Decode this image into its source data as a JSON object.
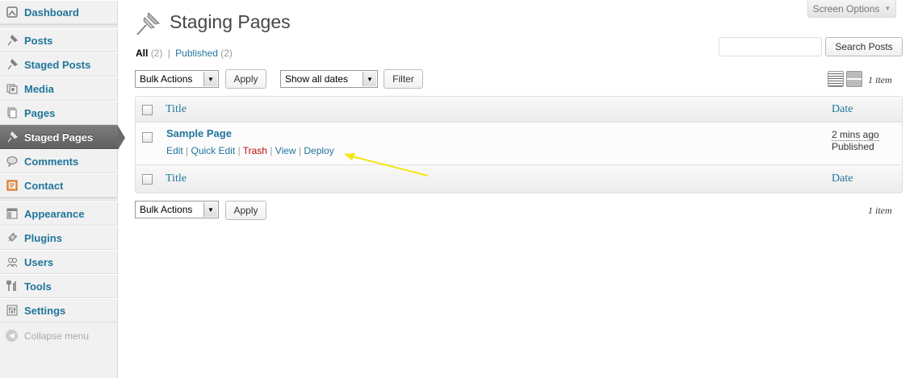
{
  "sidebar": {
    "items": [
      {
        "label": "Dashboard",
        "icon": "dashboard-icon"
      },
      {
        "label": "Posts",
        "icon": "pin-icon"
      },
      {
        "label": "Staged Posts",
        "icon": "pin-icon"
      },
      {
        "label": "Media",
        "icon": "media-icon"
      },
      {
        "label": "Pages",
        "icon": "pages-icon"
      },
      {
        "label": "Staged Pages",
        "icon": "pin-icon",
        "active": true
      },
      {
        "label": "Comments",
        "icon": "comment-icon"
      },
      {
        "label": "Contact",
        "icon": "contact-icon"
      },
      {
        "label": "Appearance",
        "icon": "appearance-icon"
      },
      {
        "label": "Plugins",
        "icon": "plugin-icon"
      },
      {
        "label": "Users",
        "icon": "users-icon"
      },
      {
        "label": "Tools",
        "icon": "tools-icon"
      },
      {
        "label": "Settings",
        "icon": "settings-icon"
      }
    ],
    "collapse_label": "Collapse menu"
  },
  "screen_options": "Screen Options",
  "page_title": "Staging Pages",
  "filters": {
    "all_label": "All",
    "all_count": "(2)",
    "separator": "|",
    "published_label": "Published",
    "published_count": "(2)"
  },
  "search": {
    "button_label": "Search Posts",
    "value": ""
  },
  "top_nav": {
    "bulk_actions": "Bulk Actions",
    "apply": "Apply",
    "dates": "Show all dates",
    "filter": "Filter",
    "items_count": "1 item"
  },
  "bottom_nav": {
    "bulk_actions": "Bulk Actions",
    "apply": "Apply",
    "items_count": "1 item"
  },
  "table": {
    "columns": {
      "title": "Title",
      "date": "Date"
    },
    "rows": [
      {
        "title": "Sample Page",
        "actions": {
          "edit": "Edit",
          "quick_edit": "Quick Edit",
          "trash": "Trash",
          "view": "View",
          "deploy": "Deploy",
          "sep": " | "
        },
        "date": "2 mins ago",
        "status": "Published"
      }
    ]
  },
  "colors": {
    "link": "#21759b",
    "trash": "#bc0b0b",
    "annotation_arrow": "#f5e613",
    "active_menu": "#6a6a6a"
  }
}
